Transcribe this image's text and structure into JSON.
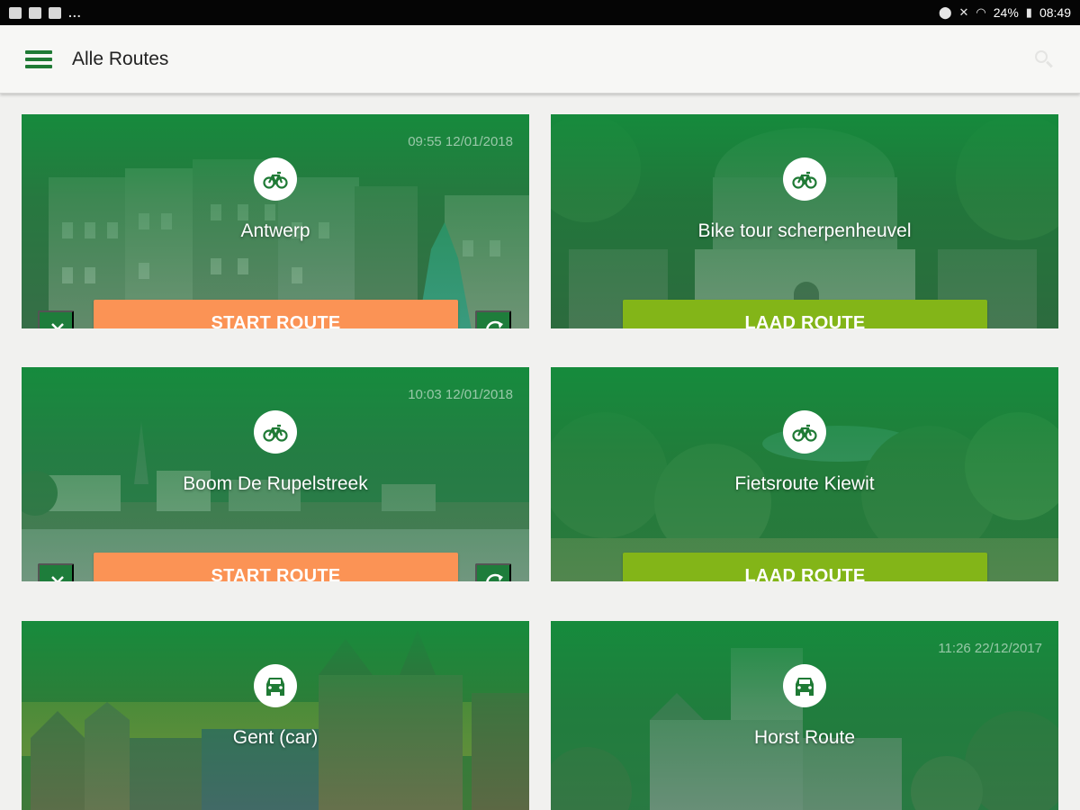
{
  "status_bar": {
    "left_icons": [
      "image-icon",
      "image-icon",
      "flipboard-icon"
    ],
    "overflow": "...",
    "right_icons": [
      "location-icon",
      "mute-icon",
      "wifi-icon"
    ],
    "battery": "24%",
    "time": "08:49"
  },
  "header": {
    "title": "Alle Routes",
    "menu_icon": "hamburger-menu-icon",
    "search_icon": "search-icon"
  },
  "colors": {
    "primary_green": "#1f7a35",
    "start_orange": "#fb9355",
    "load_green": "#83b518"
  },
  "routes": [
    {
      "title": "Antwerp",
      "timestamp": "09:55 12/01/2018",
      "mode": "bike-icon",
      "action": "START ROUTE",
      "has_delete": true,
      "has_sync": true
    },
    {
      "title": "Bike tour scherpenheuvel",
      "timestamp": "",
      "mode": "bike-icon",
      "action": "LAAD ROUTE",
      "has_delete": false,
      "has_sync": false
    },
    {
      "title": "Boom De Rupelstreek",
      "timestamp": "10:03 12/01/2018",
      "mode": "bike-icon",
      "action": "START ROUTE",
      "has_delete": true,
      "has_sync": true
    },
    {
      "title": "Fietsroute Kiewit",
      "timestamp": "",
      "mode": "bike-icon",
      "action": "LAAD ROUTE",
      "has_delete": false,
      "has_sync": false
    },
    {
      "title": "Gent (car)",
      "timestamp": "",
      "mode": "car-icon",
      "action": "",
      "has_delete": false,
      "has_sync": false
    },
    {
      "title": "Horst Route",
      "timestamp": "11:26 22/12/2017",
      "mode": "car-icon",
      "action": "",
      "has_delete": false,
      "has_sync": false
    }
  ]
}
